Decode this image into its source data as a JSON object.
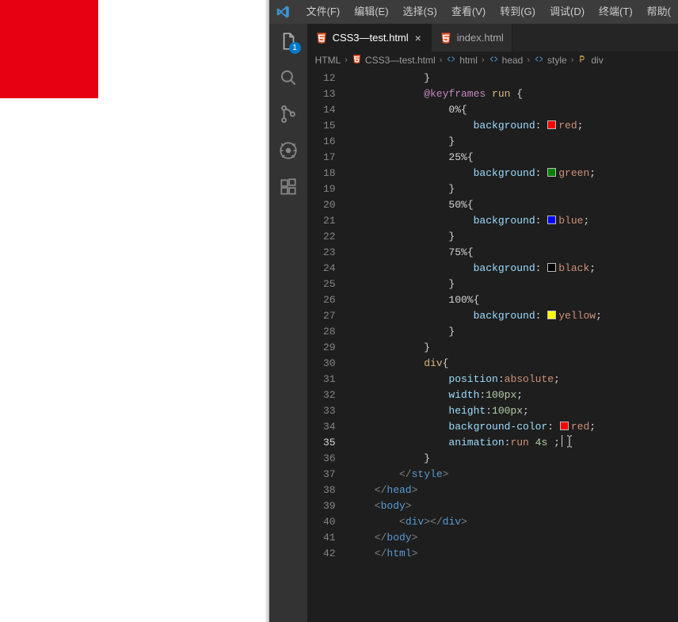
{
  "menubar": {
    "items": [
      "文件(F)",
      "编辑(E)",
      "选择(S)",
      "查看(V)",
      "转到(G)",
      "调试(D)",
      "终端(T)",
      "帮助("
    ]
  },
  "activitybar": {
    "badge": "1"
  },
  "tabs": {
    "items": [
      {
        "label": "CSS3—test.html",
        "active": true,
        "close": "×"
      },
      {
        "label": "index.html",
        "active": false,
        "close": ""
      }
    ]
  },
  "breadcrumbs": {
    "items": [
      {
        "label": "HTML",
        "icon": "none"
      },
      {
        "label": "CSS3—test.html",
        "icon": "html5"
      },
      {
        "label": "html",
        "icon": "xml"
      },
      {
        "label": "head",
        "icon": "xml"
      },
      {
        "label": "style",
        "icon": "xml"
      },
      {
        "label": "div",
        "icon": "css"
      }
    ]
  },
  "code": {
    "first_line_no": 12,
    "lines": [
      {
        "n": 12,
        "i": 3,
        "text": "}",
        "type": "brace"
      },
      {
        "n": 13,
        "i": 3,
        "tokens": [
          [
            "rule",
            "@keyframes"
          ],
          [
            "sp",
            " "
          ],
          [
            "ident",
            "run"
          ],
          [
            "sp",
            " "
          ],
          [
            "brace",
            "{"
          ]
        ]
      },
      {
        "n": 14,
        "i": 4,
        "tokens": [
          [
            "frame",
            "0%"
          ],
          [
            "brace",
            "{"
          ]
        ]
      },
      {
        "n": 15,
        "i": 5,
        "tokens": [
          [
            "prop",
            "background"
          ],
          [
            "punct",
            ":"
          ],
          [
            "sp",
            " "
          ],
          [
            "swatch",
            "#ff0000"
          ],
          [
            "val",
            "red"
          ],
          [
            "punct",
            ";"
          ]
        ]
      },
      {
        "n": 16,
        "i": 4,
        "text": "}",
        "type": "brace"
      },
      {
        "n": 17,
        "i": 4,
        "tokens": [
          [
            "frame",
            "25%"
          ],
          [
            "brace",
            "{"
          ]
        ]
      },
      {
        "n": 18,
        "i": 5,
        "tokens": [
          [
            "prop",
            "background"
          ],
          [
            "punct",
            ":"
          ],
          [
            "sp",
            " "
          ],
          [
            "swatch",
            "#008000"
          ],
          [
            "val",
            "green"
          ],
          [
            "punct",
            ";"
          ]
        ]
      },
      {
        "n": 19,
        "i": 4,
        "text": "}",
        "type": "brace"
      },
      {
        "n": 20,
        "i": 4,
        "tokens": [
          [
            "frame",
            "50%"
          ],
          [
            "brace",
            "{"
          ]
        ]
      },
      {
        "n": 21,
        "i": 5,
        "tokens": [
          [
            "prop",
            "background"
          ],
          [
            "punct",
            ":"
          ],
          [
            "sp",
            " "
          ],
          [
            "swatch",
            "#0000ff"
          ],
          [
            "val",
            "blue"
          ],
          [
            "punct",
            ";"
          ]
        ]
      },
      {
        "n": 22,
        "i": 4,
        "text": "}",
        "type": "brace"
      },
      {
        "n": 23,
        "i": 4,
        "tokens": [
          [
            "frame",
            "75%"
          ],
          [
            "brace",
            "{"
          ]
        ]
      },
      {
        "n": 24,
        "i": 5,
        "tokens": [
          [
            "prop",
            "background"
          ],
          [
            "punct",
            ":"
          ],
          [
            "sp",
            " "
          ],
          [
            "swatch",
            "#000000"
          ],
          [
            "val",
            "black"
          ],
          [
            "punct",
            ";"
          ]
        ]
      },
      {
        "n": 25,
        "i": 4,
        "text": "}",
        "type": "brace"
      },
      {
        "n": 26,
        "i": 4,
        "tokens": [
          [
            "frame",
            "100%"
          ],
          [
            "brace",
            "{"
          ]
        ]
      },
      {
        "n": 27,
        "i": 5,
        "tokens": [
          [
            "prop",
            "background"
          ],
          [
            "punct",
            ":"
          ],
          [
            "sp",
            " "
          ],
          [
            "swatch",
            "#ffff00"
          ],
          [
            "val",
            "yellow"
          ],
          [
            "punct",
            ";"
          ]
        ]
      },
      {
        "n": 28,
        "i": 4,
        "text": "}",
        "type": "brace"
      },
      {
        "n": 29,
        "i": 3,
        "text": "}",
        "type": "brace"
      },
      {
        "n": 30,
        "i": 3,
        "tokens": [
          [
            "selector",
            "div"
          ],
          [
            "brace",
            "{"
          ]
        ]
      },
      {
        "n": 31,
        "i": 4,
        "tokens": [
          [
            "prop",
            "position"
          ],
          [
            "punct",
            ":"
          ],
          [
            "val",
            "absolute"
          ],
          [
            "punct",
            ";"
          ]
        ]
      },
      {
        "n": 32,
        "i": 4,
        "tokens": [
          [
            "prop",
            "width"
          ],
          [
            "punct",
            ":"
          ],
          [
            "num",
            "100px"
          ],
          [
            "punct",
            ";"
          ]
        ]
      },
      {
        "n": 33,
        "i": 4,
        "tokens": [
          [
            "prop",
            "height"
          ],
          [
            "punct",
            ":"
          ],
          [
            "num",
            "100px"
          ],
          [
            "punct",
            ";"
          ]
        ]
      },
      {
        "n": 34,
        "i": 4,
        "tokens": [
          [
            "prop",
            "background-color"
          ],
          [
            "punct",
            ":"
          ],
          [
            "sp",
            " "
          ],
          [
            "swatch",
            "#ff0000"
          ],
          [
            "val",
            "red"
          ],
          [
            "punct",
            ";"
          ]
        ]
      },
      {
        "n": 35,
        "i": 4,
        "current": true,
        "cursor": true,
        "tokens": [
          [
            "prop",
            "animation"
          ],
          [
            "punct",
            ":"
          ],
          [
            "val",
            "run"
          ],
          [
            "sp",
            " "
          ],
          [
            "num",
            "4s"
          ],
          [
            "sp",
            " "
          ],
          [
            "punct",
            ";"
          ]
        ]
      },
      {
        "n": 36,
        "i": 3,
        "text": "}",
        "type": "brace"
      },
      {
        "n": 37,
        "i": 2,
        "tokens": [
          [
            "angle",
            "</"
          ],
          [
            "css",
            "style"
          ],
          [
            "angle",
            ">"
          ]
        ]
      },
      {
        "n": 38,
        "i": 1,
        "tokens": [
          [
            "angle",
            "</"
          ],
          [
            "tag",
            "head"
          ],
          [
            "angle",
            ">"
          ]
        ]
      },
      {
        "n": 39,
        "i": 1,
        "tokens": [
          [
            "angle",
            "<"
          ],
          [
            "tag",
            "body"
          ],
          [
            "angle",
            ">"
          ]
        ]
      },
      {
        "n": 40,
        "i": 2,
        "tokens": [
          [
            "angle",
            "<"
          ],
          [
            "tag",
            "div"
          ],
          [
            "angle",
            ">"
          ],
          [
            "angle",
            "</"
          ],
          [
            "tag",
            "div"
          ],
          [
            "angle",
            ">"
          ]
        ]
      },
      {
        "n": 41,
        "i": 1,
        "tokens": [
          [
            "angle",
            "</"
          ],
          [
            "tag",
            "body"
          ],
          [
            "angle",
            ">"
          ]
        ]
      },
      {
        "n": 42,
        "i": 1,
        "tokens": [
          [
            "angle",
            "</"
          ],
          [
            "tag",
            "html"
          ],
          [
            "angle",
            ">"
          ]
        ]
      }
    ]
  },
  "preview": {
    "box_color": "#e60012"
  }
}
